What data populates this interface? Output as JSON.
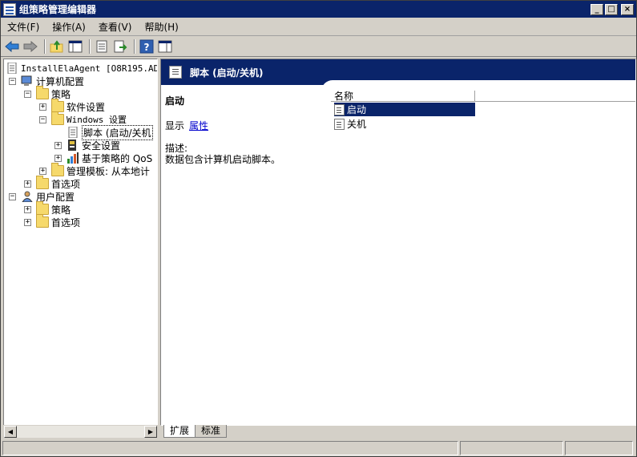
{
  "window": {
    "title": "组策略管理编辑器"
  },
  "menu": [
    "文件(F)",
    "操作(A)",
    "查看(V)",
    "帮助(H)"
  ],
  "tree": {
    "root": "InstallElaAgent [O8R195.ADMA",
    "computer_config": "计算机配置",
    "policies": "策略",
    "software_settings": "软件设置",
    "windows_settings": "Windows 设置",
    "scripts": "脚本 (启动/关机",
    "security_settings": "安全设置",
    "qos": "基于策略的 QoS",
    "admin_templates": "管理模板: 从本地计",
    "preferences": "首选项",
    "user_config": "用户配置",
    "user_policies": "策略",
    "user_preferences": "首选项"
  },
  "details": {
    "header": "脚本 (启动/关机)",
    "item_title": "启动",
    "show_label": "显示",
    "properties_link": "属性",
    "desc_label": "描述:",
    "desc_text": "数据包含计算机启动脚本。"
  },
  "list": {
    "column_name": "名称",
    "items": [
      "启动",
      "关机"
    ]
  },
  "tabs": [
    "扩展",
    "标准"
  ]
}
